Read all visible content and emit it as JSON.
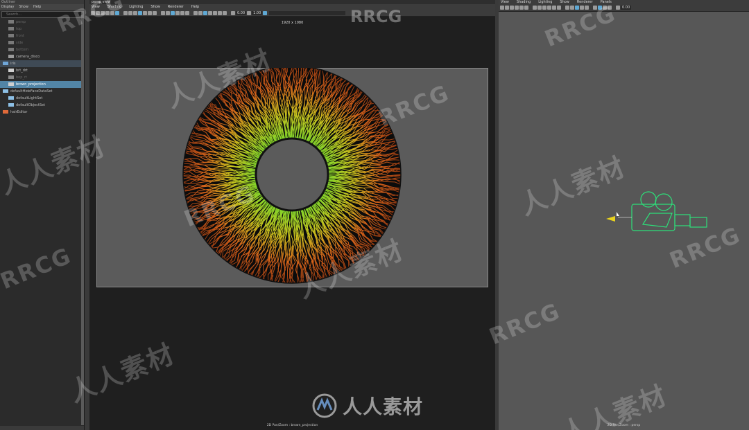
{
  "outliner": {
    "title": "Outliner",
    "menu": [
      "Display",
      "Show",
      "Help"
    ],
    "search_placeholder": "Search...",
    "items": [
      {
        "label": "persp",
        "dim": true
      },
      {
        "label": "top",
        "dim": true
      },
      {
        "label": "front",
        "dim": true
      },
      {
        "label": "side",
        "dim": true
      },
      {
        "label": "bottom",
        "dim": true
      },
      {
        "label": "camera_disco",
        "dim": false
      },
      {
        "label": "iris",
        "dim": false
      },
      {
        "label": "brt_drt",
        "dim": false
      },
      {
        "label": "bop_rt",
        "dim": true
      },
      {
        "label": "brown_projection",
        "dim": false
      },
      {
        "label": "defaultHideFaceDataSet",
        "dim": false
      },
      {
        "label": "defaultLightSet",
        "dim": false
      },
      {
        "label": "defaultObjectSet",
        "dim": false
      },
      {
        "label": "hairEditor",
        "dim": false
      }
    ]
  },
  "left_view": {
    "panel_title": "persp view",
    "menu": [
      "View",
      "Shading",
      "Lighting",
      "Show",
      "Renderer",
      "Help"
    ],
    "value_a": "0.00",
    "value_b": "1.00",
    "resolution": "1920 x 1080",
    "footer": "2D Pan/Zoom : brown_projection"
  },
  "right_view": {
    "menu": [
      "View",
      "Shading",
      "Lighting",
      "Show",
      "Renderer",
      "Panels"
    ],
    "value_a": "0.00",
    "footer": "2D Pan/Zoom : persp"
  },
  "colors": {
    "iris_inner": "#7fd42a",
    "iris_mid": "#c8c21e",
    "iris_outer": "#d8631a",
    "camera": "#2de07a",
    "selection": "#5285a6"
  },
  "watermarks": {
    "rrcg": "RRCG",
    "cn": "人人素材",
    "logo_text": "人人素材"
  }
}
